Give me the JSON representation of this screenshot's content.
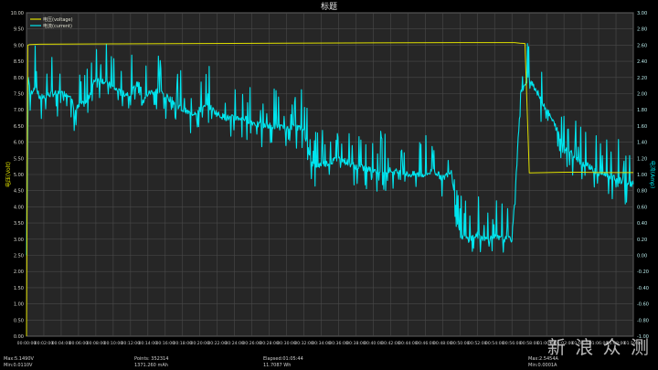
{
  "chart_data": {
    "type": "line",
    "title": "标题",
    "xlabel": "",
    "ylabel_left": "电压(Volt)",
    "ylabel_right": "电流(Amp)",
    "legend": [
      "电压(voltage)",
      "电流(current)"
    ],
    "legend_position": "top-left",
    "grid": true,
    "x_ticks": [
      "00:00:00",
      "00:02:00",
      "00:04:00",
      "00:06:00",
      "00:08:00",
      "00:10:00",
      "00:12:00",
      "00:14:00",
      "00:16:00",
      "00:18:00",
      "00:20:00",
      "00:22:00",
      "00:24:00",
      "00:26:00",
      "00:28:00",
      "00:30:00",
      "00:32:00",
      "00:34:00",
      "00:36:00",
      "00:38:00",
      "00:40:00",
      "00:42:00",
      "00:44:00",
      "00:46:00",
      "00:48:00",
      "00:50:00",
      "00:52:00",
      "00:54:00",
      "00:56:00",
      "00:58:00",
      "01:00:00",
      "01:02:00",
      "01:04:00",
      "01:06:00",
      "01:08:00",
      "01:10:00"
    ],
    "xlim_minutes": [
      0,
      70
    ],
    "ylim_left": [
      0,
      10
    ],
    "ylim_right": [
      -1.0,
      3.0
    ],
    "left_ticks": [
      "0.00",
      "0.50",
      "1.00",
      "1.50",
      "2.00",
      "2.50",
      "3.00",
      "3.50",
      "4.00",
      "4.50",
      "5.00",
      "5.50",
      "6.00",
      "6.50",
      "7.00",
      "7.50",
      "8.00",
      "8.50",
      "9.00",
      "9.50",
      "10.00"
    ],
    "right_ticks": [
      "-1.00",
      "-0.80",
      "-0.60",
      "-0.40",
      "-0.20",
      "0.00",
      "0.20",
      "0.40",
      "0.60",
      "0.80",
      "1.00",
      "1.20",
      "1.40",
      "1.60",
      "1.80",
      "2.00",
      "2.20",
      "2.40",
      "2.60",
      "2.80",
      "3.00"
    ],
    "series": [
      {
        "name": "电压(voltage)",
        "color": "#e0e000",
        "x_minutes": [
          0,
          0.15,
          0.4,
          1.5,
          10,
          20,
          30,
          40,
          50,
          56.3,
          56.9,
          57.5,
          58,
          60,
          62,
          64,
          66,
          68,
          70
        ],
        "values": [
          0,
          9.0,
          9.02,
          9.03,
          9.04,
          9.05,
          9.06,
          9.07,
          9.08,
          9.08,
          9.06,
          9.05,
          5.05,
          5.06,
          5.07,
          5.07,
          5.06,
          5.06,
          5.06
        ]
      },
      {
        "name": "电流(current)",
        "color": "#00e5ee",
        "x_minutes": [
          0,
          0.2,
          0.5,
          1,
          1.5,
          3,
          5,
          5.5,
          7,
          8,
          9,
          11,
          12,
          13,
          13.5,
          14,
          15,
          17,
          18,
          19,
          21,
          22,
          23,
          25,
          27,
          28,
          29,
          30,
          31,
          32,
          33,
          35,
          36,
          38,
          40,
          42,
          44,
          46,
          47,
          48,
          49,
          50,
          51,
          52,
          53,
          54,
          55,
          56,
          56.5,
          57,
          58,
          59,
          60,
          61,
          62,
          63,
          64,
          65,
          66,
          67,
          68,
          69,
          70
        ],
        "values": [
          0,
          2.2,
          2.0,
          2.1,
          1.95,
          2.0,
          2.0,
          1.8,
          1.9,
          2.2,
          2.15,
          2.0,
          2.0,
          2.15,
          1.9,
          2.0,
          2.05,
          1.9,
          1.8,
          1.75,
          1.85,
          1.75,
          1.7,
          1.7,
          1.6,
          1.6,
          1.6,
          1.55,
          1.6,
          1.55,
          1.1,
          1.15,
          1.2,
          1.1,
          1.05,
          1.05,
          1.0,
          1.0,
          1.05,
          0.95,
          1.05,
          0.25,
          0.2,
          0.25,
          0.2,
          0.22,
          0.2,
          0.2,
          1.0,
          2.0,
          2.2,
          2.0,
          1.8,
          1.6,
          1.35,
          1.25,
          1.15,
          1.1,
          1.0,
          1.0,
          0.95,
          0.9,
          0.88
        ]
      }
    ],
    "stats": [
      {
        "label": "Max:5.1490V",
        "sub": "Min:0.0110V"
      },
      {
        "label": "Points: 352314",
        "sub": "1371.260 mAh"
      },
      {
        "label": "Elapsed:01:05:44",
        "sub": "11.7087 Wh"
      },
      {
        "label": "Max:2.5454A",
        "sub": "Min:0.0001A"
      }
    ]
  },
  "watermark": "新 浪 众 测"
}
